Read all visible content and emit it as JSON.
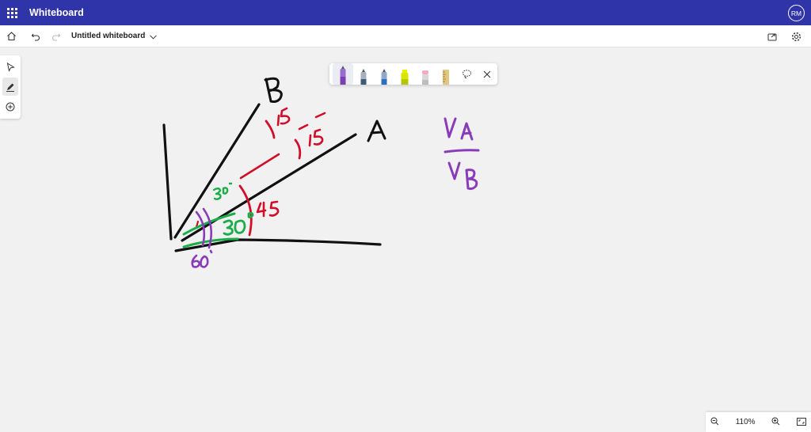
{
  "app": {
    "title": "Whiteboard",
    "user_initials": "RM"
  },
  "toolbar": {
    "document_title": "Untitled whiteboard"
  },
  "left_tools": [
    "select-tool",
    "inking-tool",
    "add-tool"
  ],
  "pens": [
    {
      "name": "purple-pen",
      "color": "#7a3fb0",
      "selected": true
    },
    {
      "name": "gray-pen",
      "color": "#707070"
    },
    {
      "name": "blue-pen",
      "color": "#2b6fc0"
    },
    {
      "name": "highlighter",
      "color": "#e8f000"
    },
    {
      "name": "pink-pen",
      "color": "#f06aa0"
    },
    {
      "name": "ruler",
      "color": "#d9b86a"
    }
  ],
  "zoom": {
    "level": "110%"
  },
  "colors": {
    "accent": "#2f34a8",
    "ink_black": "#111111",
    "ink_red": "#d0102a",
    "ink_green": "#1aad4a",
    "ink_purple": "#8a3cb8"
  },
  "board": {
    "label_b": "B",
    "label_a": "A",
    "red_15_top": "15",
    "red_15_mid": "15",
    "red_45": "45",
    "green_30_small": "30",
    "green_30_big": "30",
    "purple_60": "60",
    "ratio_top": "VA",
    "ratio_bottom": "VB"
  }
}
